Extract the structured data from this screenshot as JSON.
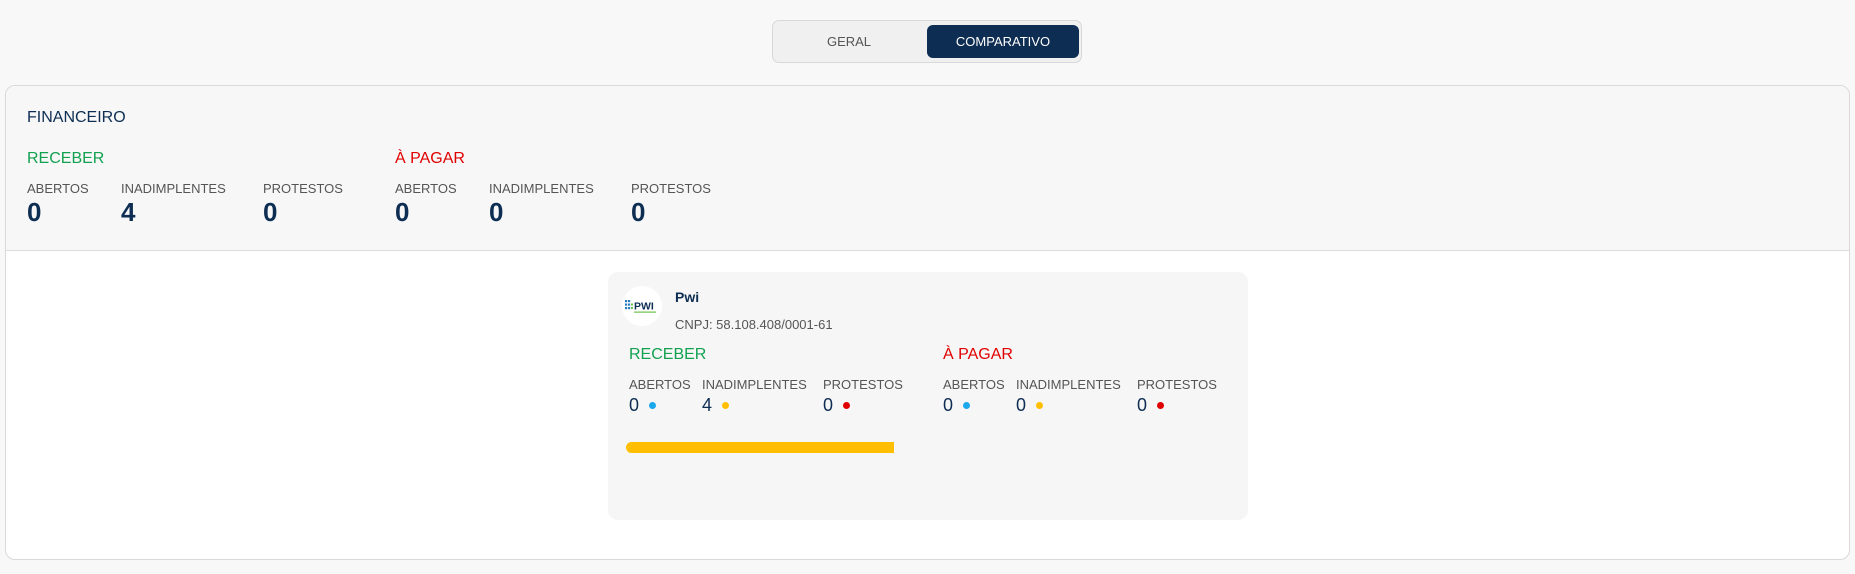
{
  "tabs": {
    "geral": "GERAL",
    "comparativo": "COMPARATIVO",
    "active": "comparativo"
  },
  "summary": {
    "title": "FINANCEIRO",
    "receber": {
      "label": "RECEBER",
      "stats": [
        {
          "label": "ABERTOS",
          "value": "0"
        },
        {
          "label": "INADIMPLENTES",
          "value": "4"
        },
        {
          "label": "PROTESTOS",
          "value": "0"
        }
      ]
    },
    "pagar": {
      "label": "À PAGAR",
      "stats": [
        {
          "label": "ABERTOS",
          "value": "0"
        },
        {
          "label": "INADIMPLENTES",
          "value": "0"
        },
        {
          "label": "PROTESTOS",
          "value": "0"
        }
      ]
    }
  },
  "company": {
    "name": "Pwi",
    "cnpj": "CNPJ: 58.108.408/0001-61",
    "logo_text": "PWI",
    "receber": {
      "label": "RECEBER",
      "stats": [
        {
          "label": "ABERTOS",
          "value": "0",
          "dot": "blue"
        },
        {
          "label": "INADIMPLENTES",
          "value": "4",
          "dot": "yellow"
        },
        {
          "label": "PROTESTOS",
          "value": "0",
          "dot": "red"
        }
      ]
    },
    "pagar": {
      "label": "À PAGAR",
      "stats": [
        {
          "label": "ABERTOS",
          "value": "0",
          "dot": "blue"
        },
        {
          "label": "INADIMPLENTES",
          "value": "0",
          "dot": "yellow"
        },
        {
          "label": "PROTESTOS",
          "value": "0",
          "dot": "red"
        }
      ]
    },
    "receber_bar": {
      "fill_fraction": 1.0,
      "color": "#ffbf00"
    }
  },
  "colors": {
    "primary": "#0d2d52",
    "receber": "#12a150",
    "pagar": "#e00000",
    "abertos": "#1aa7ec",
    "inadimplentes": "#ffbf00",
    "protestos": "#e00000"
  }
}
